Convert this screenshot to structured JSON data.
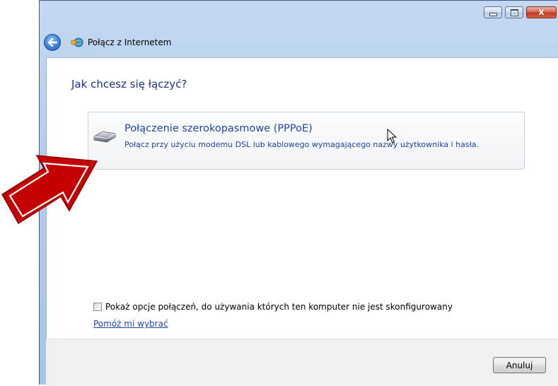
{
  "window": {
    "title": "Połącz z Internetem",
    "caption_buttons": [
      "minimize",
      "maximize",
      "close"
    ],
    "close_glyph": "x"
  },
  "content": {
    "question": "Jak chcesz się łączyć?",
    "option": {
      "icon": "modem-icon",
      "title": "Połączenie szerokopasmowe (PPPoE)",
      "description": "Połącz przy użyciu modemu DSL lub kablowego wymagającego nazwy użytkownika i hasła."
    },
    "checkbox": {
      "label": "Pokaż opcje połączeń, do używania których ten komputer nie jest skonfigurowany",
      "checked": false
    },
    "help_link": "Pomóż mi wybrać"
  },
  "footer": {
    "cancel_label": "Anuluj"
  },
  "colors": {
    "link_blue": "#1f45a8",
    "question_blue": "#1e3287",
    "annotation_arrow": "#c00000"
  }
}
